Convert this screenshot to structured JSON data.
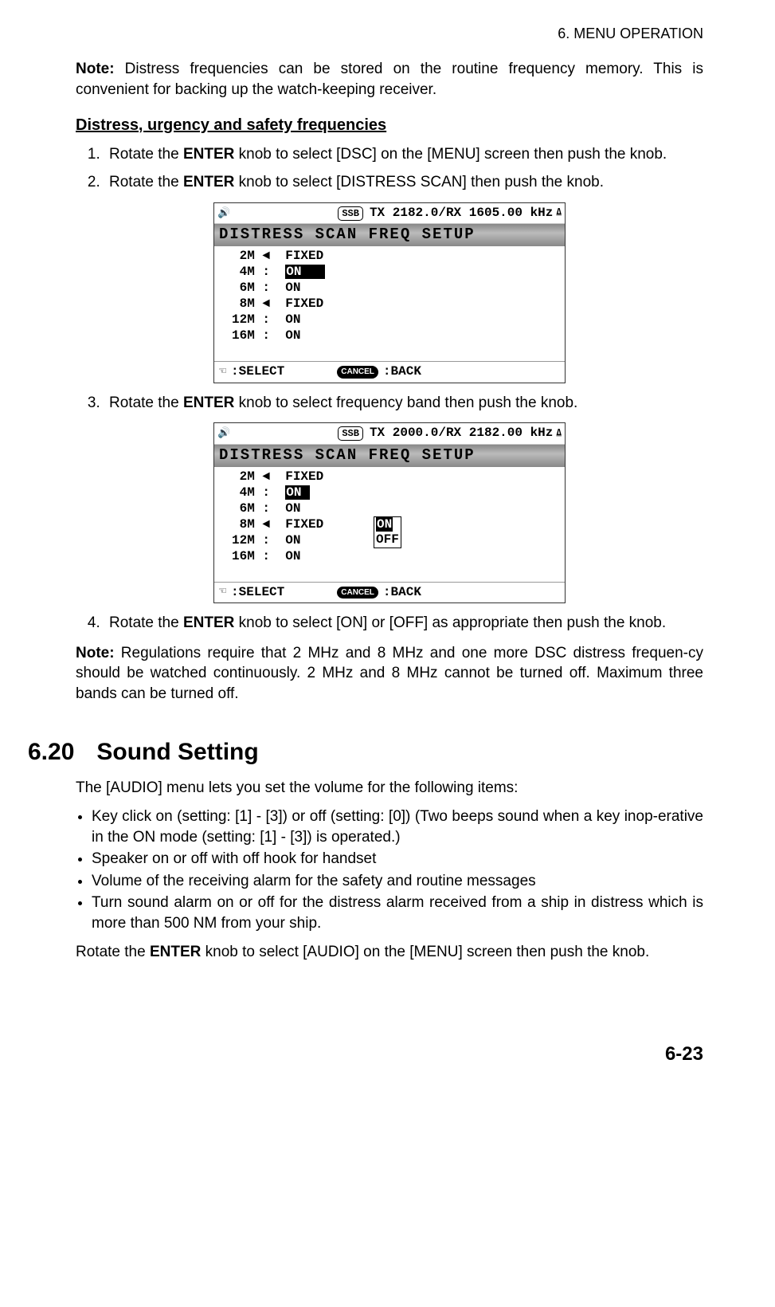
{
  "header": "6.  MENU OPERATION",
  "note1": {
    "label": "Note:",
    "text": " Distress frequencies can be stored on the routine frequency memory. This is convenient for backing up the watch-keeping receiver."
  },
  "subheading": "Distress, urgency and safety frequencies",
  "step1": {
    "pre": "Rotate the ",
    "bold": "ENTER",
    "post": " knob to select [DSC] on the [MENU] screen then push the knob."
  },
  "step2": {
    "pre": "Rotate the ",
    "bold": "ENTER",
    "post": " knob to select [DISTRESS SCAN] then push the knob."
  },
  "screen1": {
    "ssb": "SSB",
    "freq": "TX 2182.0/RX 1605.00 kHz",
    "title": "DISTRESS SCAN FREQ SETUP",
    "rows": {
      "r1": " 2M ◄  FIXED",
      "r2a": " 4M :  ",
      "r2b": "ON   ",
      "r3": " 6M :  ON",
      "r4": " 8M ◄  FIXED",
      "r5": "12M :  ON",
      "r6": "16M :  ON"
    },
    "footerSelect": ":SELECT",
    "footerCancel": "CANCEL",
    "footerBack": ":BACK"
  },
  "step3": {
    "pre": "Rotate the ",
    "bold": "ENTER",
    "post": " knob to select frequency band then push the knob."
  },
  "screen2": {
    "ssb": "SSB",
    "freq": "TX 2000.0/RX 2182.00 kHz",
    "title": "DISTRESS SCAN FREQ SETUP",
    "rows": {
      "r1": " 2M ◄  FIXED",
      "r2a": " 4M :  ",
      "r2b": "ON ",
      "r3": " 6M :  ON",
      "r4": " 8M ◄  FIXED",
      "r5": "12M :  ON",
      "r6": "16M :  ON"
    },
    "popup": {
      "on": "ON ",
      "off": "OFF"
    },
    "footerSelect": ":SELECT",
    "footerCancel": "CANCEL",
    "footerBack": ":BACK"
  },
  "step4": {
    "pre": "Rotate the ",
    "bold": "ENTER",
    "post": " knob to select [ON] or [OFF] as appropriate then push the knob."
  },
  "note2": {
    "label": "Note:",
    "text": " Regulations require that 2 MHz and 8 MHz and one more DSC distress frequen-cy should be watched continuously. 2 MHz and 8 MHz cannot be turned off. Maximum three bands can be turned off."
  },
  "section": {
    "num": "6.20",
    "title": "Sound Setting",
    "intro": "The [AUDIO] menu lets you set the volume for the following items:",
    "b1": "Key click on (setting: [1] - [3]) or off (setting: [0]) (Two beeps sound when a key inop-erative in the ON mode (setting: [1] - [3]) is operated.)",
    "b2": "Speaker on or off with off hook for handset",
    "b3": "Volume of the receiving alarm for the safety and routine messages",
    "b4": "Turn sound alarm on or off for the distress alarm received from a ship in distress which is more than 500 NM from your ship.",
    "closing_pre": "Rotate the ",
    "closing_bold": "ENTER",
    "closing_post": " knob to select [AUDIO] on the [MENU] screen then push the knob."
  },
  "pageNum": "6-23"
}
